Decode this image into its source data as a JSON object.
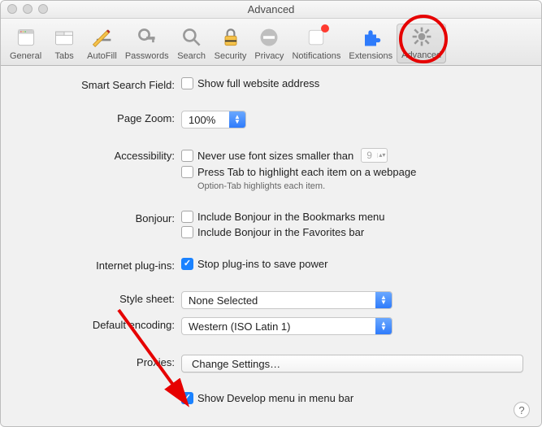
{
  "window": {
    "title": "Advanced"
  },
  "toolbar": {
    "items": [
      {
        "name": "general",
        "label": "General"
      },
      {
        "name": "tabs",
        "label": "Tabs"
      },
      {
        "name": "autofill",
        "label": "AutoFill"
      },
      {
        "name": "passwords",
        "label": "Passwords"
      },
      {
        "name": "search",
        "label": "Search"
      },
      {
        "name": "security",
        "label": "Security"
      },
      {
        "name": "privacy",
        "label": "Privacy"
      },
      {
        "name": "notifications",
        "label": "Notifications"
      },
      {
        "name": "extensions",
        "label": "Extensions"
      },
      {
        "name": "advanced",
        "label": "Advanced"
      }
    ],
    "selected": "advanced"
  },
  "settings": {
    "smartSearch": {
      "label": "Smart Search Field:",
      "showFullAddr": {
        "text": "Show full website address",
        "checked": false
      }
    },
    "pageZoom": {
      "label": "Page Zoom:",
      "value": "100%"
    },
    "accessibility": {
      "label": "Accessibility:",
      "minFont": {
        "text": "Never use font sizes smaller than",
        "checked": false,
        "value": "9"
      },
      "tabHighlight": {
        "text": "Press Tab to highlight each item on a webpage",
        "checked": false
      },
      "hint": "Option-Tab highlights each item."
    },
    "bonjour": {
      "label": "Bonjour:",
      "inBookmarks": {
        "text": "Include Bonjour in the Bookmarks menu",
        "checked": false
      },
      "inFavorites": {
        "text": "Include Bonjour in the Favorites bar",
        "checked": false
      }
    },
    "plugins": {
      "label": "Internet plug-ins:",
      "stopSave": {
        "text": "Stop plug-ins to save power",
        "checked": true
      }
    },
    "styleSheet": {
      "label": "Style sheet:",
      "value": "None Selected"
    },
    "encoding": {
      "label": "Default encoding:",
      "value": "Western (ISO Latin 1)"
    },
    "proxies": {
      "label": "Proxies:",
      "button": "Change Settings…"
    },
    "developMenu": {
      "text": "Show Develop menu in menu bar",
      "checked": true
    }
  },
  "helpTooltip": "?"
}
